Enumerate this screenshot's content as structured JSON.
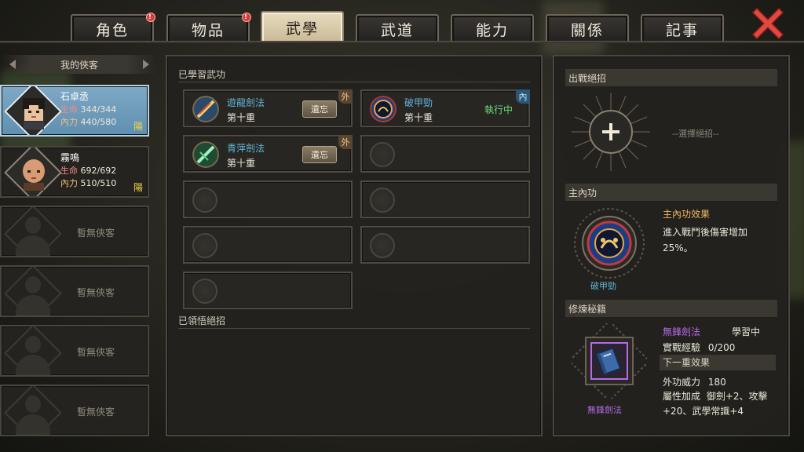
{
  "tabs": [
    {
      "label": "角色",
      "badge": "!"
    },
    {
      "label": "物品",
      "badge": "!"
    },
    {
      "label": "武學",
      "active": true
    },
    {
      "label": "武道"
    },
    {
      "label": "能力"
    },
    {
      "label": "關係"
    },
    {
      "label": "記事"
    }
  ],
  "close_icon": "close-x-icon",
  "left": {
    "title": "我的俠客",
    "characters": [
      {
        "name": "石卓丞",
        "hp_label": "生命",
        "hp": "344/344",
        "mp_label": "內力",
        "mp": "440/580",
        "trait": "陽"
      },
      {
        "name": "霧鳴",
        "hp_label": "生命",
        "hp": "692/692",
        "mp_label": "內力",
        "mp": "510/510",
        "trait": "陽"
      }
    ],
    "empty_label": "暫無俠客"
  },
  "center": {
    "learned_title": "已學習武功",
    "comprehended_title": "已領悟絕招",
    "skills": [
      {
        "name": "遊龍劍法",
        "level": "第十重",
        "action": "遺忘",
        "tag": "外"
      },
      {
        "name": "破甲勁",
        "level": "第十重",
        "status": "執行中",
        "tag": "內"
      },
      {
        "name": "青萍劍法",
        "level": "第十重",
        "action": "遺忘",
        "tag": "外"
      }
    ]
  },
  "right": {
    "ultimate_title": "出戰絕招",
    "ultimate_hint": "--選擇絕招--",
    "main_inner_title": "主內功",
    "main_inner_effect_title": "主內功效果",
    "main_inner_effect": "進入戰鬥後傷害增加25%。",
    "main_inner_name": "破甲勁",
    "cultivate_title": "修煉秘籍",
    "book_name": "無鋒劍法",
    "book_status": "學習中",
    "exp_label": "實戰經驗",
    "exp_value": "0/200",
    "next_title": "下一重效果",
    "power_label": "外功威力",
    "power_value": "180",
    "bonus_label": "屬性加成",
    "bonus_value": "御劍+2、攻擊+20、武學常識+4",
    "book_caption": "無鋒劍法"
  },
  "colors": {
    "skill_name": "#5fb6d8",
    "running": "#6fdc7a",
    "purple": "#b56be6",
    "selected_card": "#6f9fc0"
  }
}
